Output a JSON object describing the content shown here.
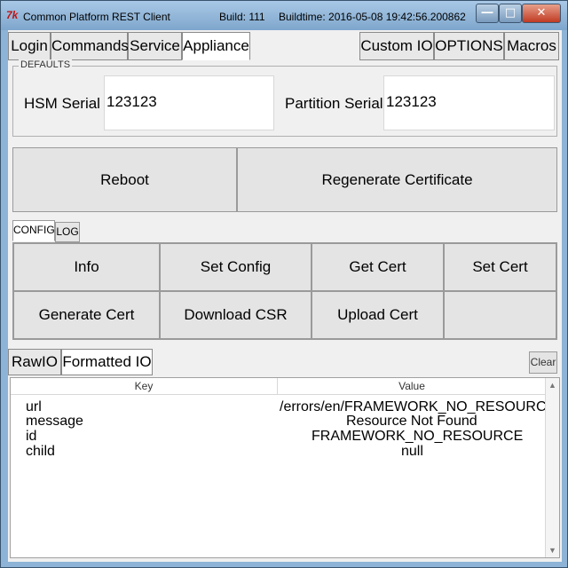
{
  "window": {
    "app_icon": "7k",
    "title": "Common Platform REST Client",
    "build": "Build: 111",
    "buildtime": "Buildtime: 2016-05-08 19:42:56.200862",
    "controls": {
      "minimize": "―",
      "maximize": "□",
      "close": "✕"
    }
  },
  "menu": {
    "tabs": [
      "Login",
      "Commands",
      "Service",
      "Appliance"
    ],
    "active": "Appliance",
    "right_tabs": [
      "Custom IO",
      "OPTIONS",
      "Macros"
    ]
  },
  "defaults": {
    "legend": "DEFAULTS",
    "hsm_serial_label": "HSM Serial",
    "hsm_serial_value": "123123",
    "partition_serial_label": "Partition Serial",
    "partition_serial_value": "123123"
  },
  "actions": {
    "reboot": "Reboot",
    "regen": "Regenerate Certificate"
  },
  "subtabs": {
    "config": "CONFIG",
    "log": "LOG",
    "active": "CONFIG"
  },
  "config_buttons": {
    "info": "Info",
    "set_config": "Set Config",
    "get_cert": "Get Cert",
    "set_cert": "Set Cert",
    "generate_cert": "Generate Cert",
    "download_csr": "Download CSR",
    "upload_cert": "Upload Cert"
  },
  "io": {
    "tabs": [
      "RawIO",
      "Formatted IO"
    ],
    "active": "Formatted IO",
    "clear": "Clear"
  },
  "table": {
    "headers": {
      "key": "Key",
      "value": "Value"
    },
    "rows": [
      {
        "key": "url",
        "value": "/errors/en/FRAMEWORK_NO_RESOURCE"
      },
      {
        "key": "message",
        "value": "Resource Not Found"
      },
      {
        "key": "id",
        "value": "FRAMEWORK_NO_RESOURCE"
      },
      {
        "key": "child",
        "value": "null"
      }
    ]
  },
  "colors": {
    "title_gradient": "#8db3d6",
    "close": "#c03a22",
    "client_bg": "#f0f0f0"
  }
}
